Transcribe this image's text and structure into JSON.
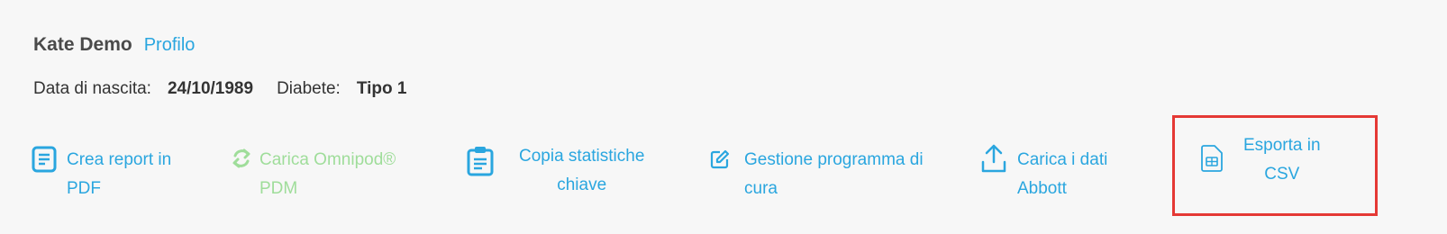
{
  "patient": {
    "name": "Kate Demo",
    "profile_link": "Profilo",
    "dob_label": "Data di nascita:",
    "dob_value": "24/10/1989",
    "diabetes_label": "Diabete:",
    "diabetes_value": "Tipo 1"
  },
  "actions": {
    "pdf_report": {
      "line1": "Crea report in",
      "line2": "PDF",
      "icon": "document-icon"
    },
    "omnipod": {
      "line1": "Carica Omnipod®",
      "line2": "PDM",
      "icon": "sync-icon",
      "state": "disabled"
    },
    "copy_stats": {
      "line1": "Copia statistiche",
      "line2": "chiave",
      "icon": "clipboard-icon"
    },
    "care_program": {
      "line1": "Gestione programma di",
      "line2": "cura",
      "icon": "edit-icon"
    },
    "abbott_upload": {
      "line1": "Carica i dati",
      "line2": "Abbott",
      "icon": "upload-icon"
    },
    "csv_export": {
      "line1": "Esporta in",
      "line2": "CSV",
      "icon": "csv-file-icon"
    }
  },
  "colors": {
    "link": "#2aa6df",
    "disabled": "#9fdd9a",
    "highlight": "#e53935",
    "background": "#f7f7f7"
  }
}
